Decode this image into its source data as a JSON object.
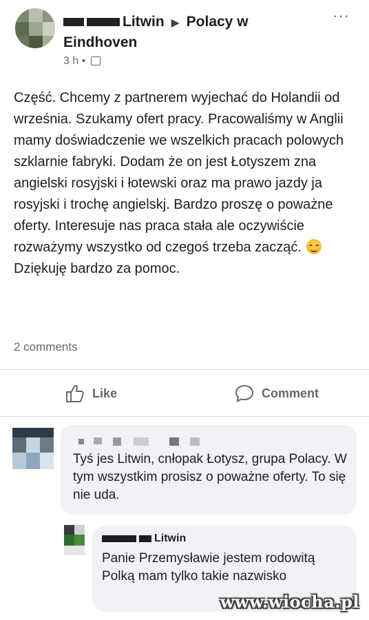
{
  "post": {
    "author_visible": "Litwin",
    "arrow": "▶",
    "group": "Polacy w Eindhoven",
    "time": "3 h",
    "separator": "•",
    "more": "···",
    "text_part1": "Część. Chcemy z partnerem wyjechać do Holandii od września. Szukamy ofert pracy. Pracowaliśmy w Anglii mamy doświadczenie we wszelkich pracach polowych szklarnie fabryki. Dodam że on jest Łotyszem zna angielski rosyjski i łotewski oraz ma prawo jazdy ja rosyjski i trochę angielskj. Bardzo proszę o poważne oferty. Interesuje nas praca stała ale oczywiście rozważymy wszystko od czegoś trzeba zacząć.",
    "text_part2": "Dziękuję bardzo za pomoc.",
    "comments_count": "2 comments"
  },
  "actions": {
    "like": "Like",
    "comment": "Comment"
  },
  "comments": [
    {
      "text": "Tyś jes Litwin, cnłopak Łotysz, grupa Polacy. W tym wszystkim prosisz o poważne oferty. To się nie uda."
    },
    {
      "author_visible": "Litwin",
      "text": "Panie Przemysławie jestem rodowitą  Polką mam tylko takie nazwisko"
    }
  ],
  "watermark": "www.wiocha.pl",
  "icons": {
    "like": "thumbs-up-icon",
    "comment": "speech-bubble-icon",
    "audience": "group-icon",
    "more": "more-options-icon"
  }
}
